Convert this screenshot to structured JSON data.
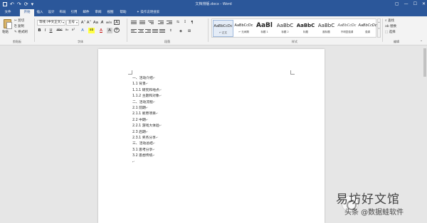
{
  "window": {
    "title": "文档排版.docx - Word",
    "quick_access": [
      "↶",
      "↷",
      "⟳",
      "▾"
    ],
    "controls": [
      "▢",
      "—",
      "☐",
      "✕"
    ]
  },
  "ribbon_tabs": [
    "文件",
    "开始",
    "插入",
    "设计",
    "布局",
    "引用",
    "邮件",
    "审阅",
    "视图",
    "帮助"
  ],
  "active_tab": "开始",
  "tell_me": "操作说明搜索",
  "clipboard": {
    "paste": "粘贴",
    "cut": "✂ 剪切",
    "copy": "⎘ 复制",
    "format_painter": "✎ 格式刷",
    "group_label": "剪贴板"
  },
  "font": {
    "font_name": "等线 (中文正文)",
    "font_size": "五号",
    "grow": "A˄",
    "shrink": "A˅",
    "case": "Aa",
    "clear": "A̸",
    "wen": "wén",
    "border_a": "A",
    "bold": "B",
    "italic": "I",
    "underline": "U",
    "strike": "abc",
    "subscript": "x₂",
    "superscript": "x²",
    "effects": "A",
    "highlight": "ab",
    "color": "A",
    "shade": "A",
    "circle": "字",
    "group_label": "字体"
  },
  "paragraph": {
    "group_label": "段落"
  },
  "styles": {
    "items": [
      {
        "sample": "AaBbCcDc",
        "name": "↵ 正文"
      },
      {
        "sample": "AaBbCcDc",
        "name": "↵ 无间隔"
      },
      {
        "sample": "AaBl",
        "name": "标题 1"
      },
      {
        "sample": "AaBbC",
        "name": "标题 2"
      },
      {
        "sample": "AaBbC",
        "name": "标题"
      },
      {
        "sample": "AaBbC",
        "name": "副标题"
      },
      {
        "sample": "AaBbCcDc",
        "name": "不明显强调"
      },
      {
        "sample": "AaBbCcDc",
        "name": "强调"
      }
    ],
    "group_label": "样式"
  },
  "editing": {
    "find": "⌕ 查找",
    "replace": "ab 替换",
    "select": "⬚ 选择",
    "group_label": "编辑"
  },
  "document": {
    "lines": [
      "一、活动介绍",
      "1.1 背景",
      "1.1.1 研究和地点",
      "1.1.2 主题和对象",
      "二、活动流程",
      "2.1 前期",
      "2.1.1 新原项目",
      "2.2 中期",
      "2.2.1 游戏大体验",
      "2.3 后期",
      "2.3.1 奖务分享",
      "三、活动总结",
      "3.1 思考分享",
      "3.2 思想传统",
      ""
    ],
    "paragraph_mark": "↵"
  },
  "watermark": {
    "big": "易坊好文馆",
    "small": "头条 @数据蛙软件"
  }
}
